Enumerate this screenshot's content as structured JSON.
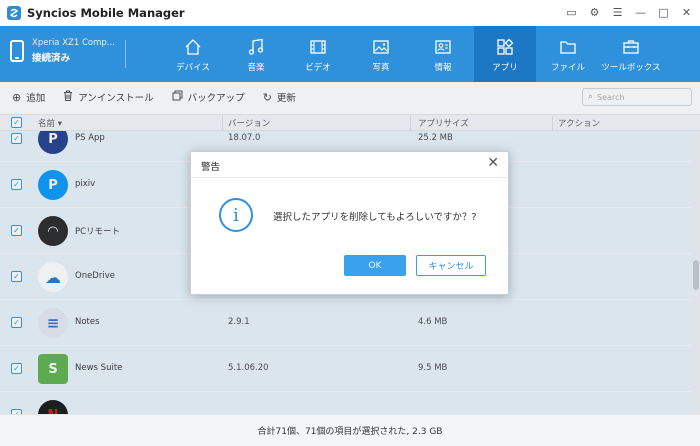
{
  "app": {
    "title": "Syncios Mobile Manager"
  },
  "window_controls": [
    {
      "name": "message-icon",
      "glyph": "▭"
    },
    {
      "name": "settings-icon",
      "glyph": "⚙"
    },
    {
      "name": "menu-icon",
      "glyph": "☰"
    },
    {
      "name": "minimize-icon",
      "glyph": "—"
    },
    {
      "name": "maximize-icon",
      "glyph": "□"
    },
    {
      "name": "close-icon",
      "glyph": "✕"
    }
  ],
  "device": {
    "name": "Xperia XZ1 Comp...",
    "status": "接続済み"
  },
  "nav": {
    "active_index": 5,
    "items": [
      {
        "label": "デバイス",
        "icon": "home-icon"
      },
      {
        "label": "音楽",
        "icon": "music-icon"
      },
      {
        "label": "ビデオ",
        "icon": "video-icon"
      },
      {
        "label": "写真",
        "icon": "photo-icon"
      },
      {
        "label": "情報",
        "icon": "contact-card-icon"
      },
      {
        "label": "アプリ",
        "icon": "apps-icon"
      },
      {
        "label": "ファイル",
        "icon": "folder-icon"
      },
      {
        "label": "ツールボックス",
        "icon": "toolbox-icon"
      }
    ]
  },
  "toolbar": {
    "add_label": "追加",
    "uninstall_label": "アンインストール",
    "backup_label": "バックアップ",
    "refresh_label": "更新",
    "search_placeholder": "Search"
  },
  "table": {
    "columns": [
      "名前",
      "バージョン",
      "アプリサイズ",
      "アクション"
    ],
    "rows": [
      {
        "name": "PS App",
        "version": "18.07.0",
        "size": "25.2 MB",
        "icon": "playstation-icon",
        "color": "#1b3a8a",
        "glyph": "P",
        "checked": true
      },
      {
        "name": "pixiv",
        "version": "",
        "size": "",
        "icon": "pixiv-icon",
        "color": "#0096fa",
        "glyph": "P",
        "checked": true
      },
      {
        "name": "PCリモート",
        "version": "",
        "size": "",
        "icon": "pc-remote-icon",
        "color": "#222222",
        "glyph": "◠",
        "checked": true
      },
      {
        "name": "OneDrive",
        "version": "",
        "size": "",
        "icon": "onedrive-icon",
        "color": "#ffffff",
        "glyph": "☁",
        "checked": true
      },
      {
        "name": "Notes",
        "version": "2.9.1",
        "size": "4.6 MB",
        "icon": "notes-icon",
        "color": "#e4e9f2",
        "glyph": "≡",
        "checked": true
      },
      {
        "name": "News Suite",
        "version": "5.1.06.20",
        "size": "9.5 MB",
        "icon": "news-suite-icon",
        "color": "#5bb04a",
        "glyph": "S",
        "checked": true
      },
      {
        "name": "",
        "version": "",
        "size": "",
        "icon": "netflix-icon",
        "color": "#111111",
        "glyph": "N",
        "checked": true
      }
    ]
  },
  "status": {
    "text": "合計71個、71個の項目が選択された, 2.3 GB"
  },
  "dialog": {
    "title": "警告",
    "message": "選択したアプリを削除してもよろしいですか？?",
    "ok_label": "OK",
    "cancel_label": "キャンセル"
  },
  "colors": {
    "accent": "#2f91dc",
    "active_nav": "#1c78c4",
    "row_selected": "#e8f3fb"
  }
}
